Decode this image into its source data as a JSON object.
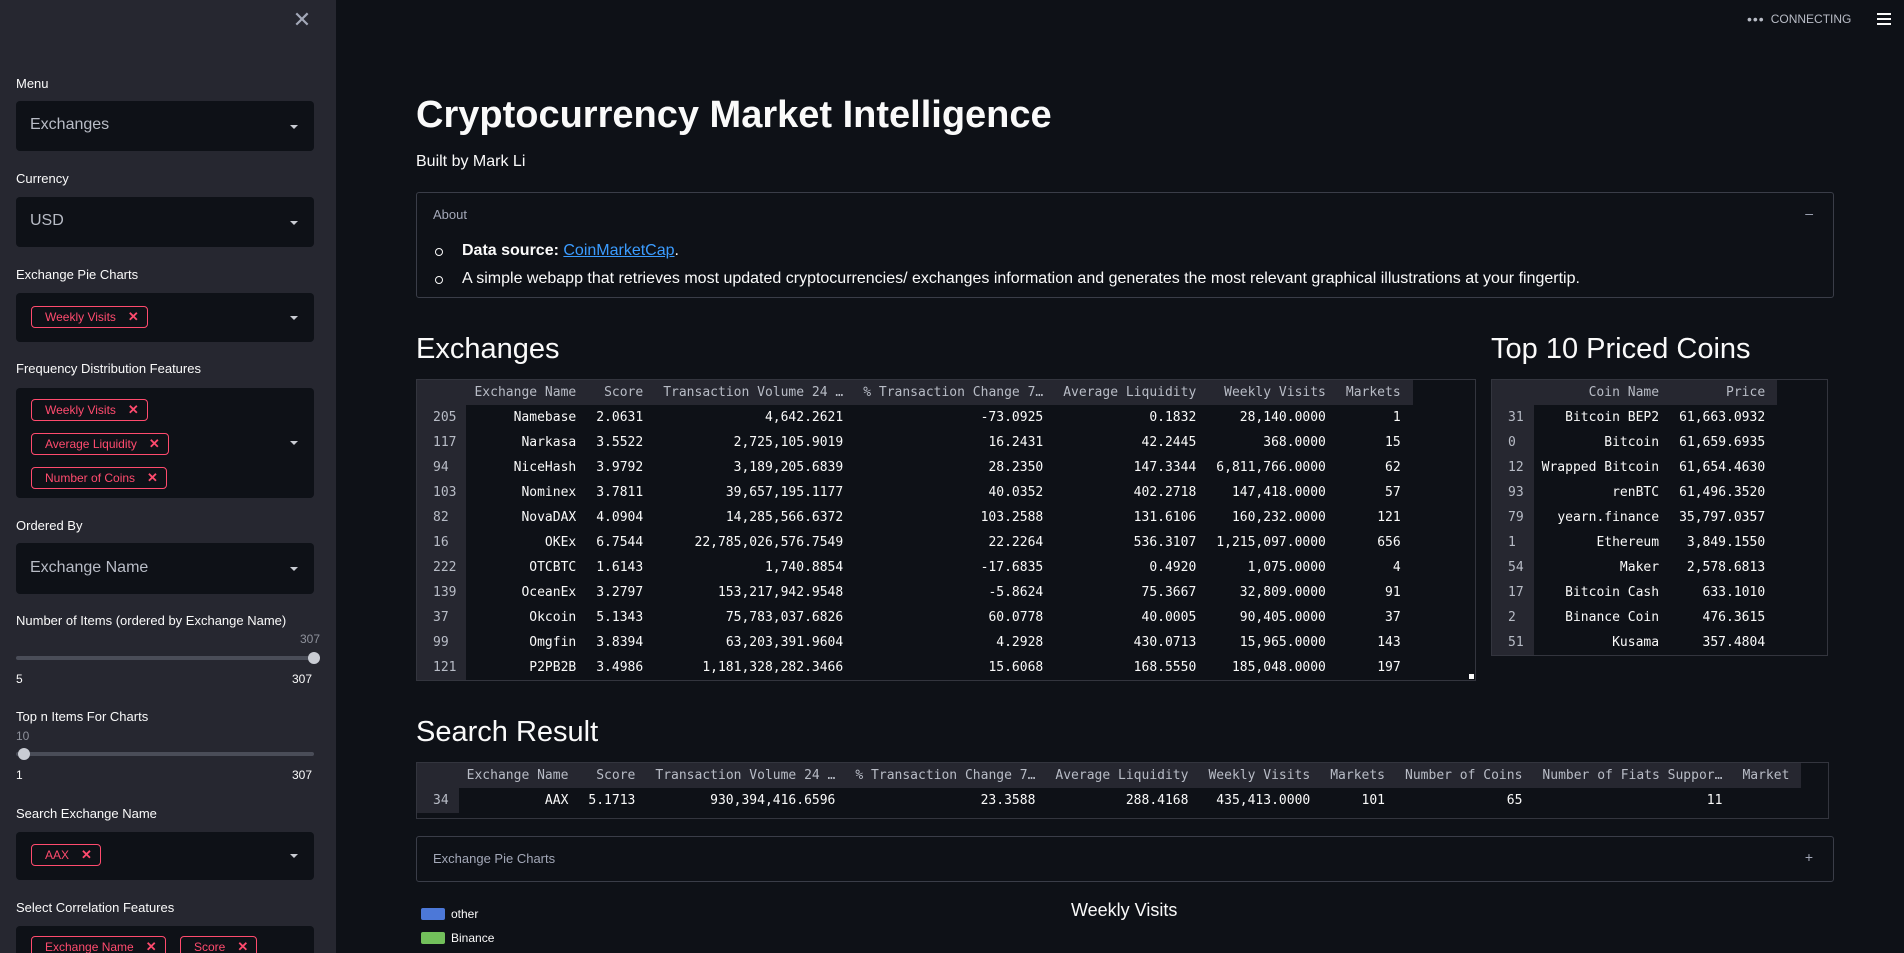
{
  "sidebar": {
    "menu_label": "Menu",
    "menu_value": "Exchanges",
    "currency_label": "Currency",
    "currency_value": "USD",
    "pie_label": "Exchange Pie Charts",
    "pie_tags": [
      "Weekly Visits"
    ],
    "freq_label": "Frequency Distribution Features",
    "freq_tags": [
      "Weekly Visits",
      "Average Liquidity",
      "Number of Coins"
    ],
    "ordered_label": "Ordered By",
    "ordered_value": "Exchange Name",
    "num_items_label": "Number of Items (ordered by Exchange Name)",
    "num_items_value": "307",
    "num_items_min": "5",
    "num_items_max": "307",
    "topn_label": "Top n Items For Charts",
    "topn_value": "10",
    "topn_min": "1",
    "topn_max": "307",
    "search_label": "Search Exchange Name",
    "search_tags": [
      "AAX"
    ],
    "corr_label": "Select Correlation Features",
    "corr_tags": [
      "Exchange Name",
      "Score"
    ]
  },
  "header": {
    "status": "CONNECTING"
  },
  "main": {
    "title": "Cryptocurrency Market Intelligence",
    "byline": "Built by Mark Li",
    "about": {
      "header": "About",
      "toggle": "–",
      "source_label": "Data source: ",
      "source_link": "CoinMarketCap",
      "source_end": ".",
      "description": "A simple webapp that retrieves most updated cryptocurrencies/ exchanges information and generates the most relevant graphical illustrations at your fingertip."
    },
    "exchanges_heading": "Exchanges",
    "top10_heading": "Top 10 Priced Coins",
    "search_heading": "Search Result",
    "pie_expander": {
      "header": "Exchange Pie Charts",
      "toggle": "+"
    },
    "chart_title": "Weekly Visits",
    "legend": [
      {
        "label": "other",
        "color": "#4c78d8"
      },
      {
        "label": "Binance",
        "color": "#72c05b"
      }
    ]
  },
  "exchanges_table": {
    "columns": [
      "",
      "Exchange Name",
      "Score",
      "Transaction Volume 24 …",
      "% Transaction Change 7…",
      "Average Liquidity",
      "Weekly Visits",
      "Markets"
    ],
    "rows": [
      [
        "205",
        "Namebase",
        "2.0631",
        "4,642.2621",
        "-73.0925",
        "0.1832",
        "28,140.0000",
        "1"
      ],
      [
        "117",
        "Narkasa",
        "3.5522",
        "2,725,105.9019",
        "16.2431",
        "42.2445",
        "368.0000",
        "15"
      ],
      [
        "94",
        "NiceHash",
        "3.9792",
        "3,189,205.6839",
        "28.2350",
        "147.3344",
        "6,811,766.0000",
        "62"
      ],
      [
        "103",
        "Nominex",
        "3.7811",
        "39,657,195.1177",
        "40.0352",
        "402.2718",
        "147,418.0000",
        "57"
      ],
      [
        "82",
        "NovaDAX",
        "4.0904",
        "14,285,566.6372",
        "103.2588",
        "131.6106",
        "160,232.0000",
        "121"
      ],
      [
        "16",
        "OKEx",
        "6.7544",
        "22,785,026,576.7549",
        "22.2264",
        "536.3107",
        "1,215,097.0000",
        "656"
      ],
      [
        "222",
        "OTCBTC",
        "1.6143",
        "1,740.8854",
        "-17.6835",
        "0.4920",
        "1,075.0000",
        "4"
      ],
      [
        "139",
        "OceanEx",
        "3.2797",
        "153,217,942.9548",
        "-5.8624",
        "75.3667",
        "32,809.0000",
        "91"
      ],
      [
        "37",
        "Okcoin",
        "5.1343",
        "75,783,037.6826",
        "60.0778",
        "40.0005",
        "90,405.0000",
        "37"
      ],
      [
        "99",
        "Omgfin",
        "3.8394",
        "63,203,391.9604",
        "4.2928",
        "430.0713",
        "15,965.0000",
        "143"
      ],
      [
        "121",
        "P2PB2B",
        "3.4986",
        "1,181,328,282.3466",
        "15.6068",
        "168.5550",
        "185,048.0000",
        "197"
      ]
    ]
  },
  "top10_table": {
    "columns": [
      "",
      "Coin Name",
      "Price"
    ],
    "rows": [
      [
        "31",
        "Bitcoin BEP2",
        "61,663.0932"
      ],
      [
        "0",
        "Bitcoin",
        "61,659.6935"
      ],
      [
        "12",
        "Wrapped Bitcoin",
        "61,654.4630"
      ],
      [
        "93",
        "renBTC",
        "61,496.3520"
      ],
      [
        "79",
        "yearn.finance",
        "35,797.0357"
      ],
      [
        "1",
        "Ethereum",
        "3,849.1550"
      ],
      [
        "54",
        "Maker",
        "2,578.6813"
      ],
      [
        "17",
        "Bitcoin Cash",
        "633.1010"
      ],
      [
        "2",
        "Binance Coin",
        "476.3615"
      ],
      [
        "51",
        "Kusama",
        "357.4804"
      ]
    ]
  },
  "search_table": {
    "columns": [
      "",
      "Exchange Name",
      "Score",
      "Transaction Volume 24 …",
      "% Transaction Change 7…",
      "Average Liquidity",
      "Weekly Visits",
      "Markets",
      "Number of Coins",
      "Number of Fiats Suppor…",
      "Market"
    ],
    "rows": [
      [
        "34",
        "AAX",
        "5.1713",
        "930,394,416.6596",
        "23.3588",
        "288.4168",
        "435,413.0000",
        "101",
        "65",
        "11",
        ""
      ]
    ]
  }
}
